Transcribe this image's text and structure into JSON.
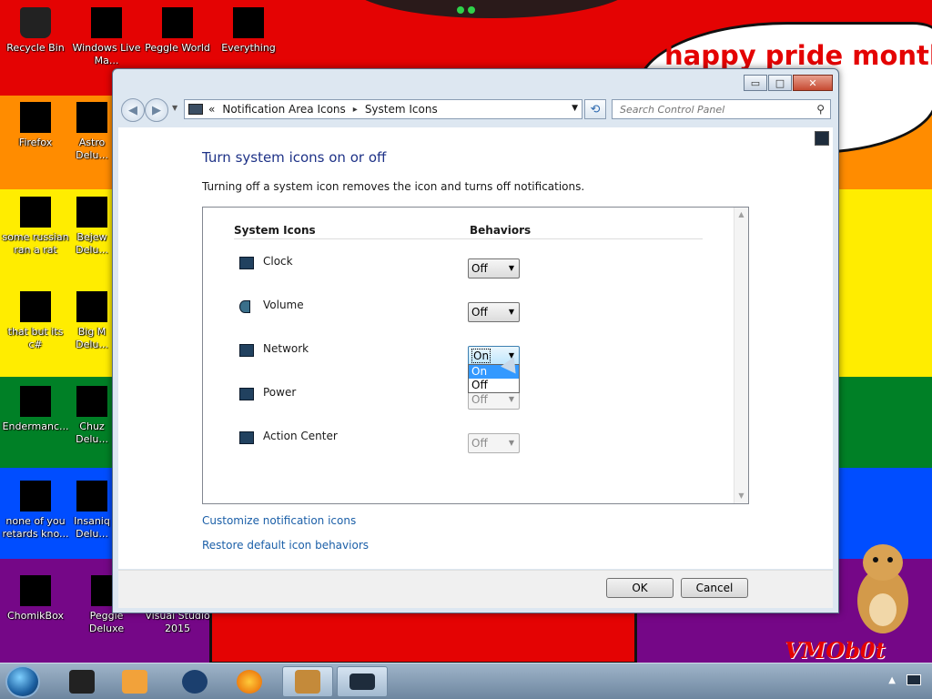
{
  "desktop": {
    "wallpaper_text": "happy pride month",
    "brand_text": "VMOb0t",
    "icons": [
      {
        "label": "Recycle Bin"
      },
      {
        "label": "Windows Live Ma..."
      },
      {
        "label": "Peggle World"
      },
      {
        "label": "Everything"
      },
      {
        "label": "Firefox"
      },
      {
        "label": "Astro Delu..."
      },
      {
        "label": "some russian ran a rat"
      },
      {
        "label": "Bejew Delu..."
      },
      {
        "label": "that but its c#"
      },
      {
        "label": "Big M Delu..."
      },
      {
        "label": "Endermanc..."
      },
      {
        "label": "Chuz Delu..."
      },
      {
        "label": "none of you retards kno..."
      },
      {
        "label": "Insaniq Delu..."
      },
      {
        "label": "ChomikBox"
      },
      {
        "label": "Peggle Deluxe"
      },
      {
        "label": "Visual Studio 2015"
      }
    ]
  },
  "window": {
    "caption": {
      "minimize": "▭",
      "maximize": "□",
      "close": "✕"
    },
    "breadcrumb": {
      "prefix": "«",
      "items": [
        "Notification Area Icons",
        "System Icons"
      ],
      "separator": "▸"
    },
    "search": {
      "placeholder": "Search Control Panel"
    },
    "page_title": "Turn system icons on or off",
    "page_description": "Turning off a system icon removes the icon and turns off notifications.",
    "table": {
      "col_system_icons": "System Icons",
      "col_behaviors": "Behaviors",
      "rows": [
        {
          "name": "Clock",
          "value": "Off",
          "enabled": true
        },
        {
          "name": "Volume",
          "value": "Off",
          "enabled": true
        },
        {
          "name": "Network",
          "value": "On",
          "enabled": true
        },
        {
          "name": "Power",
          "value": "Off",
          "enabled": false
        },
        {
          "name": "Action Center",
          "value": "Off",
          "enabled": false
        }
      ]
    },
    "dropdown_options": [
      "On",
      "Off"
    ],
    "dropdown_selected": "On",
    "links": {
      "customize": "Customize notification icons",
      "restore": "Restore default icon behaviors"
    },
    "buttons": {
      "ok": "OK",
      "cancel": "Cancel"
    }
  },
  "taskbar": {
    "items": [
      {
        "icon": "start-orb"
      },
      {
        "icon": "dark-app-icon"
      },
      {
        "icon": "media-player-icon"
      },
      {
        "icon": "globe-icon"
      },
      {
        "icon": "firefox-icon"
      },
      {
        "icon": "chomikbox-icon",
        "active": true
      },
      {
        "icon": "control-panel-icon",
        "active": true
      }
    ]
  },
  "colors": {
    "accent_link": "#1b5fa8",
    "title_blue": "#1e3287",
    "selection": "#3399ff"
  }
}
